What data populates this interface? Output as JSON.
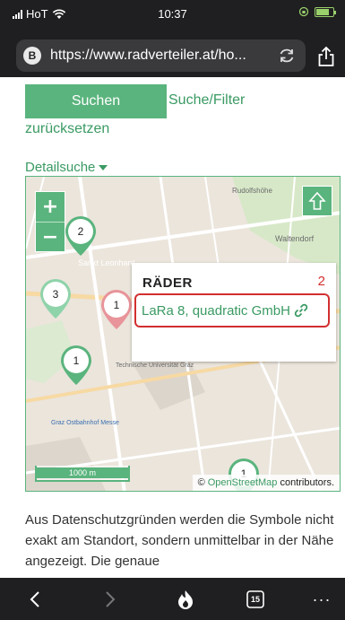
{
  "status": {
    "carrier": "HoT",
    "time": "10:37"
  },
  "browser": {
    "site_badge": "B",
    "url": "https://www.radverteiler.at/ho..."
  },
  "actions": {
    "search_label": "Suchen",
    "reset_label_line1": "Suche/Filter",
    "reset_label_line2": "zurücksetzen",
    "detail_label": "Detailsuche"
  },
  "map": {
    "zoom_in": "+",
    "zoom_out": "−",
    "labels": {
      "rudolf": "Rudolfshöhe",
      "waltendorf": "Waltendorf",
      "sankt_leonhard": "Sankt Leonhard",
      "tu": "Technische Universität Graz",
      "ostbahnhof": "Graz Ostbahnhof Messe"
    },
    "markers": [
      {
        "count": "2",
        "color": "#5ab47d"
      },
      {
        "count": "3",
        "color": "#8fd3aa"
      },
      {
        "count": "1",
        "color": "#e8949a"
      },
      {
        "count": "1",
        "color": "#5ab47d"
      },
      {
        "count": "1",
        "color": "#5ab47d"
      }
    ],
    "popup": {
      "title": "RÄDER",
      "number": "2",
      "link": "LaRa 8, quadratic GmbH"
    },
    "scale": "1000 m",
    "attribution_prefix": "©",
    "attribution_link": "OpenStreetMap",
    "attribution_suffix": "contributors."
  },
  "paragraph": "Aus Datenschutzgründen werden die Symbole nicht exakt am Standort, sondern unmittelbar in der Nähe angezeigt. Die genaue",
  "toolbar": {
    "tabs_count": "15",
    "more": "···"
  },
  "colors": {
    "accent": "#5ab47d",
    "link": "#3a9a63",
    "highlight": "#d32f2f",
    "dark": "#1f1f21"
  }
}
